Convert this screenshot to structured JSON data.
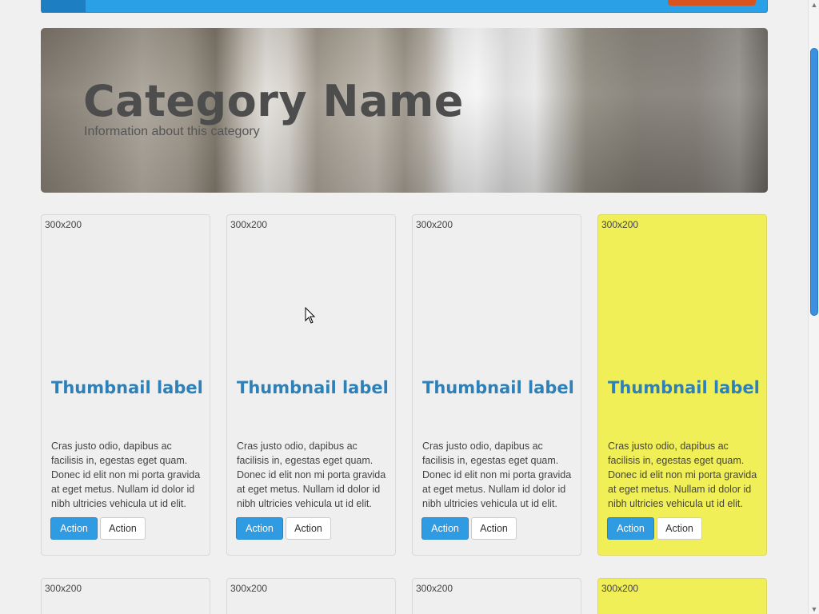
{
  "hero": {
    "title": "Category Name",
    "subtitle": "Information about this category"
  },
  "thumbnails": [
    {
      "image": "300x200",
      "label": "Thumbnail label",
      "text": "Cras justo odio, dapibus ac facilisis in, egestas eget quam. Donec id elit non mi porta gravida at eget metus. Nullam id dolor id nibh ultricies vehicula ut id elit.",
      "primary_label": "Action",
      "secondary_label": "Action",
      "highlighted": false
    },
    {
      "image": "300x200",
      "label": "Thumbnail label",
      "text": "Cras justo odio, dapibus ac facilisis in, egestas eget quam. Donec id elit non mi porta gravida at eget metus. Nullam id dolor id nibh ultricies vehicula ut id elit.",
      "primary_label": "Action",
      "secondary_label": "Action",
      "highlighted": false
    },
    {
      "image": "300x200",
      "label": "Thumbnail label",
      "text": "Cras justo odio, dapibus ac facilisis in, egestas eget quam. Donec id elit non mi porta gravida at eget metus. Nullam id dolor id nibh ultricies vehicula ut id elit.",
      "primary_label": "Action",
      "secondary_label": "Action",
      "highlighted": false
    },
    {
      "image": "300x200",
      "label": "Thumbnail label",
      "text": "Cras justo odio, dapibus ac facilisis in, egestas eget quam. Donec id elit non mi porta gravida at eget metus. Nullam id dolor id nibh ultricies vehicula ut id elit.",
      "primary_label": "Action",
      "secondary_label": "Action",
      "highlighted": true
    }
  ],
  "thumbnails_row2": [
    {
      "image": "300x200",
      "highlighted": false
    },
    {
      "image": "300x200",
      "highlighted": false
    },
    {
      "image": "300x200",
      "highlighted": false
    },
    {
      "image": "300x200",
      "highlighted": true
    }
  ],
  "colors": {
    "accent": "#2aa0e6",
    "highlight": "#f1ef58",
    "label": "#2e80b8",
    "nav_button": "#d9531e"
  },
  "icons": {
    "scroll_up": "scroll-up-arrow-icon",
    "scroll_down": "scroll-down-arrow-icon",
    "cursor": "mouse-pointer-icon"
  }
}
